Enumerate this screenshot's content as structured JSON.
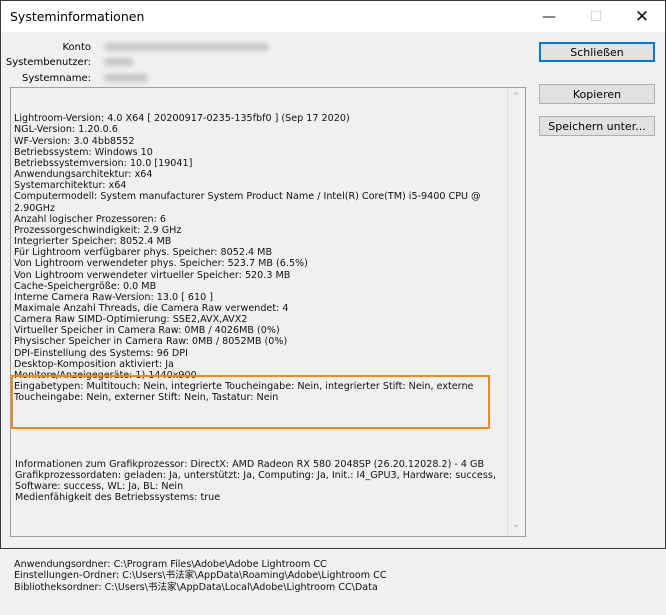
{
  "window": {
    "title": "Systeminformationen"
  },
  "labels": {
    "konto": "Konto",
    "systembenutzer": "Systembenutzer:",
    "systemname": "Systemname:"
  },
  "buttons": {
    "close": "Schließen",
    "copy": "Kopieren",
    "save": "Speichern unter..."
  },
  "info_lines": [
    "Lightroom-Version: 4.0 X64 [ 20200917-0235-135fbf0 ] (Sep 17 2020)",
    "NGL-Version: 1.20.0.6",
    "WF-Version: 3.0 4bb8552",
    "Betriebssystem: Windows 10",
    "Betriebssystemversion: 10.0 [19041]",
    "Anwendungsarchitektur: x64",
    "Systemarchitektur: x64",
    "Computermodell: System manufacturer System Product Name / Intel(R) Core(TM) i5-9400 CPU @ 2.90GHz",
    "Anzahl logischer Prozessoren: 6",
    "Prozessorgeschwindigkeit: 2.9 GHz",
    "Integrierter Speicher: 8052.4 MB",
    "Für Lightroom verfügbarer phys. Speicher: 8052.4 MB",
    "Von Lightroom verwendeter phys. Speicher: 523.7 MB (6.5%)",
    "Von Lightroom verwendeter virtueller Speicher: 520.3 MB",
    "Cache-Speichergröße: 0.0 MB",
    "Interne Camera Raw-Version: 13.0 [ 610 ]",
    "Maximale Anzahl Threads, die Camera Raw verwendet: 4",
    "Camera Raw SIMD-Optimierung: SSE2,AVX,AVX2",
    "Virtueller Speicher in Camera Raw: 0MB / 4026MB (0%)",
    "Physischer Speicher in Camera Raw: 0MB / 8052MB (0%)",
    "DPI-Einstellung des Systems: 96 DPI",
    "Desktop-Komposition aktiviert: Ja",
    "Monitore/Anzeigegeräte: 1) 1440x900",
    "Eingabetypen: Multitouch: Nein, integrierte Toucheingabe: Nein, integrierter Stift: Nein, externe Toucheingabe: Nein, externer Stift: Nein, Tastatur: Nein"
  ],
  "gpu_lines": [
    "Informationen zum Grafikprozessor: DirectX: AMD Radeon RX 580 2048SP (26.20.12028.2) - 4 GB",
    "Grafikprozessordaten: geladen: Ja, unterstützt: Ja, Computing: Ja, Init.: I4_GPU3, Hardware: success, Software: success, WL: Ja, BL: Nein",
    "Medienfähigkeit des Betriebssystems: true"
  ],
  "folder_lines": [
    "Anwendungsordner: C:\\Program Files\\Adobe\\Adobe Lightroom CC",
    "Einstellungen-Ordner: C:\\Users\\书法家\\AppData\\Roaming\\Adobe\\Lightroom CC",
    "Bibliotheksordner: C:\\Users\\书法家\\AppData\\Local\\Adobe\\Lightroom CC\\Data"
  ],
  "colors": {
    "highlight": "#f08a1c",
    "focus": "#0078d7"
  }
}
